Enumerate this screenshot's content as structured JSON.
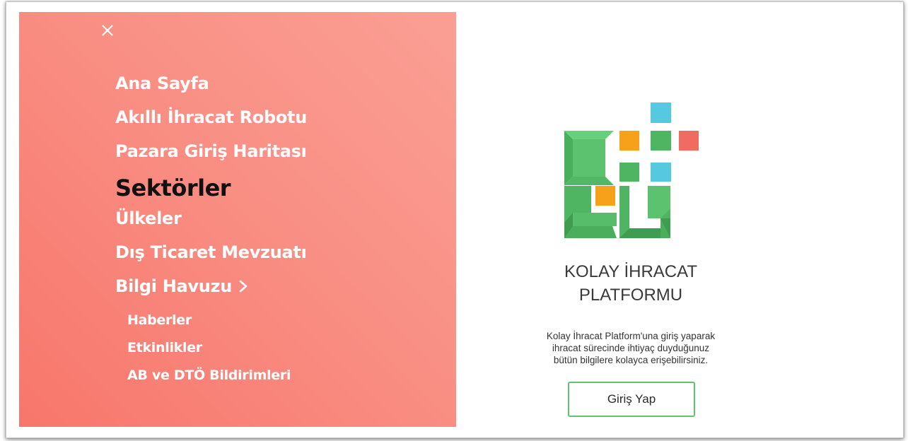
{
  "menu": {
    "close_icon": "close-icon",
    "items": [
      {
        "label": "Ana Sayfa"
      },
      {
        "label": "Akıllı İhracat Robotu"
      },
      {
        "label": "Pazara Giriş Haritası"
      },
      {
        "label": "Sektörler",
        "active": true
      },
      {
        "label": "Ülkeler"
      },
      {
        "label": "Dış Ticaret Mevzuatı"
      },
      {
        "label": "Bilgi Havuzu",
        "icon": "chevron-right-icon"
      }
    ],
    "subitems": [
      {
        "label": "Haberler"
      },
      {
        "label": "Etkinlikler"
      },
      {
        "label": "AB ve DTÖ Bildirimleri"
      }
    ]
  },
  "brand": {
    "title_line1": "KOLAY İHRACAT",
    "title_line2": "PLATFORMU",
    "description_lines": [
      "Kolay İhracat Platform'una giriş yaparak",
      "ihracat sürecinde ihtiyaç duyduğunuz",
      "bütün bilgilere kolayca erişebilirsiniz."
    ],
    "login_button": "Giriş Yap"
  },
  "colors": {
    "panel_gradient_start": "#f8766b",
    "panel_gradient_end": "#fa9f94",
    "logo_green": "#4fb563",
    "logo_orange": "#f7a11a",
    "logo_cyan": "#56c9e0",
    "logo_red": "#f06b62",
    "button_border": "#5cc46a"
  }
}
